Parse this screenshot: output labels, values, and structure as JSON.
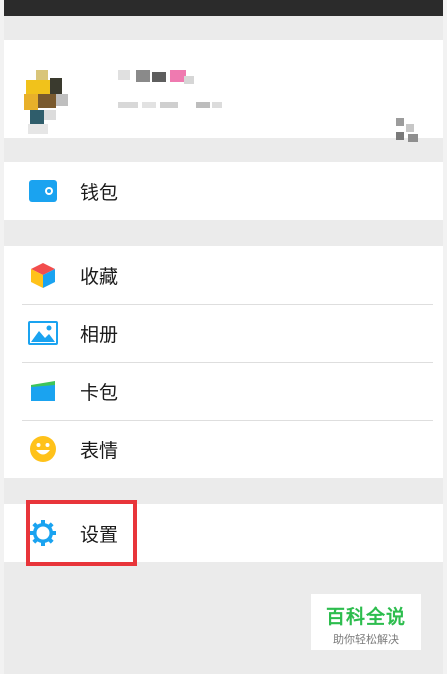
{
  "menu": {
    "wallet": {
      "label": "钱包",
      "icon": "wallet-icon"
    },
    "favorites": {
      "label": "收藏",
      "icon": "cube-icon"
    },
    "album": {
      "label": "相册",
      "icon": "image-icon"
    },
    "cards": {
      "label": "卡包",
      "icon": "card-icon"
    },
    "stickers": {
      "label": "表情",
      "icon": "smiley-icon"
    },
    "settings": {
      "label": "设置",
      "icon": "gear-icon"
    }
  },
  "watermark": {
    "title": "百科全说",
    "subtitle": "助你轻松解决"
  },
  "colors": {
    "accent": "#1aa3f0",
    "highlight": "#e8353a",
    "watermark_green": "#2dbd4e",
    "background": "#ebebeb"
  }
}
